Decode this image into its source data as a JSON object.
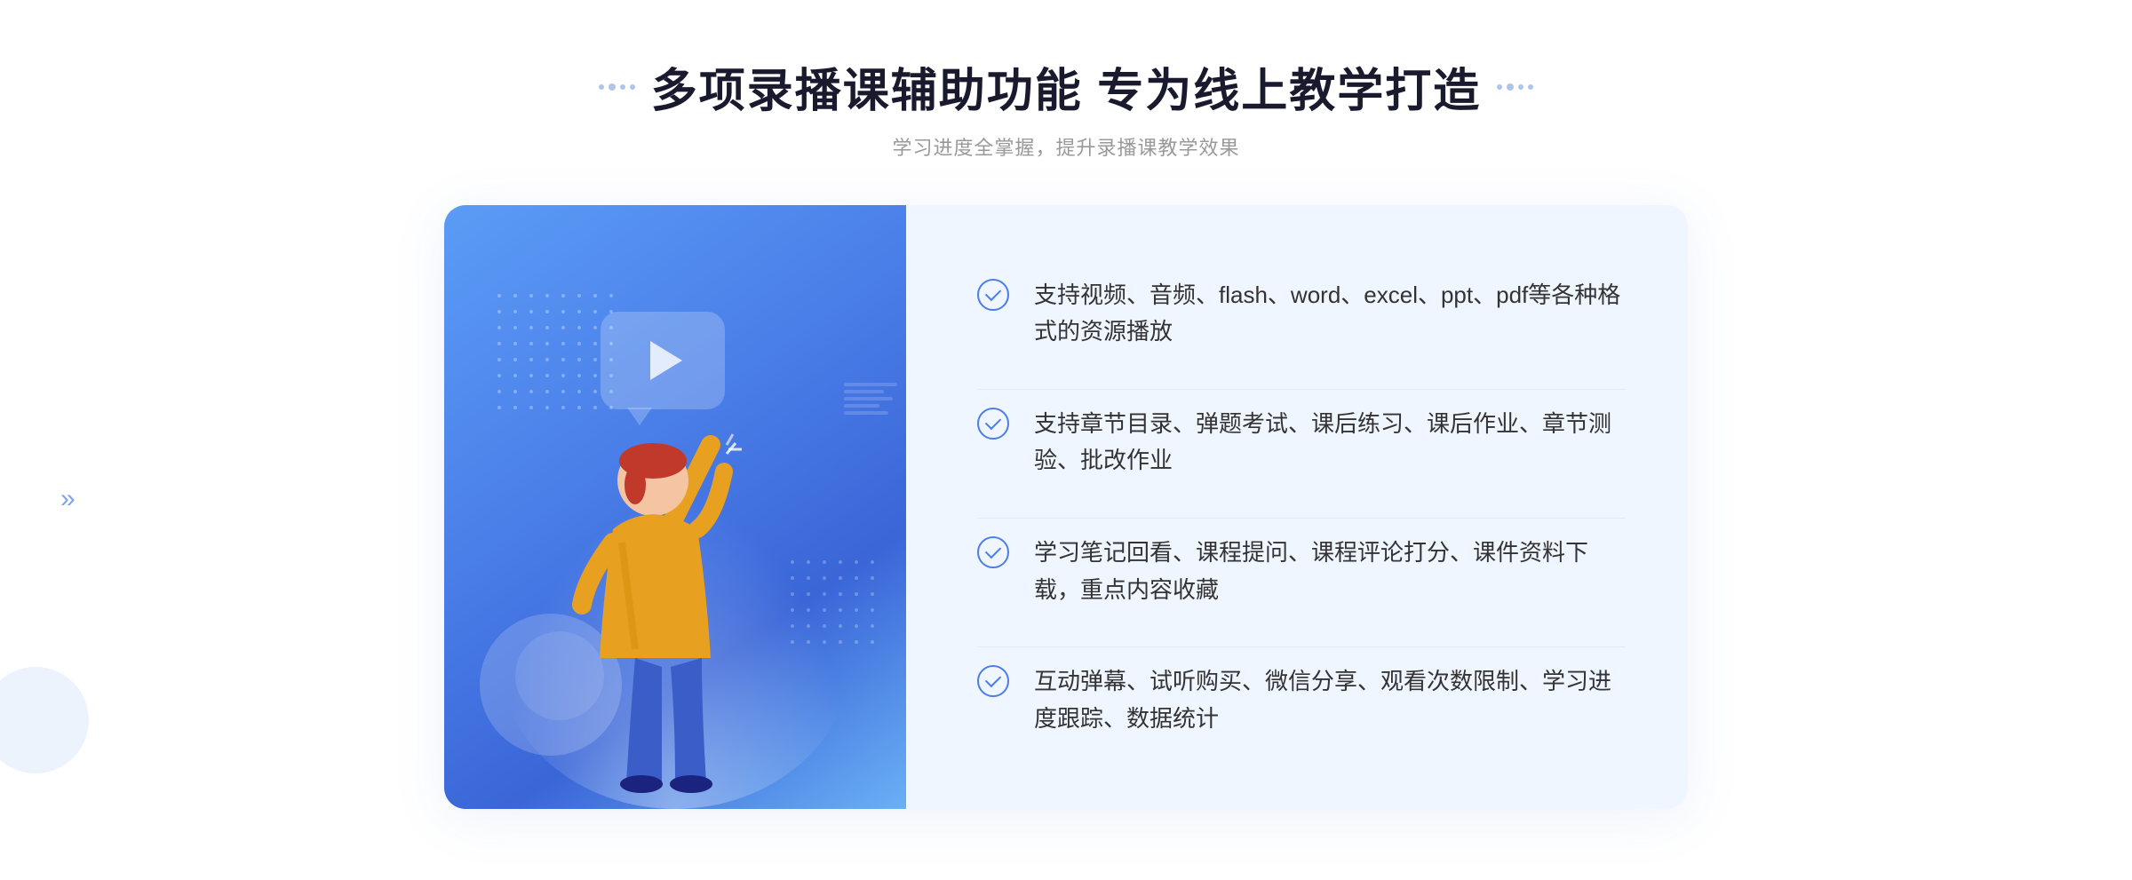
{
  "page": {
    "title": "多项录播课辅助功能 专为线上教学打造",
    "subtitle": "学习进度全掌握，提升录播课教学效果",
    "title_deco_left": "❖",
    "title_deco_right": "❖"
  },
  "features": [
    {
      "id": 1,
      "text": "支持视频、音频、flash、word、excel、ppt、pdf等各种格式的资源播放"
    },
    {
      "id": 2,
      "text": "支持章节目录、弹题考试、课后练习、课后作业、章节测验、批改作业"
    },
    {
      "id": 3,
      "text": "学习笔记回看、课程提问、课程评论打分、课件资料下载，重点内容收藏"
    },
    {
      "id": 4,
      "text": "互动弹幕、试听购买、微信分享、观看次数限制、学习进度跟踪、数据统计"
    }
  ],
  "colors": {
    "accent_blue": "#4a7ee8",
    "light_blue_bg": "#f0f6ff",
    "gradient_start": "#5b9cf6",
    "gradient_end": "#3a66d8",
    "text_dark": "#1a1a2e",
    "text_gray": "#999999",
    "text_body": "#333333"
  }
}
